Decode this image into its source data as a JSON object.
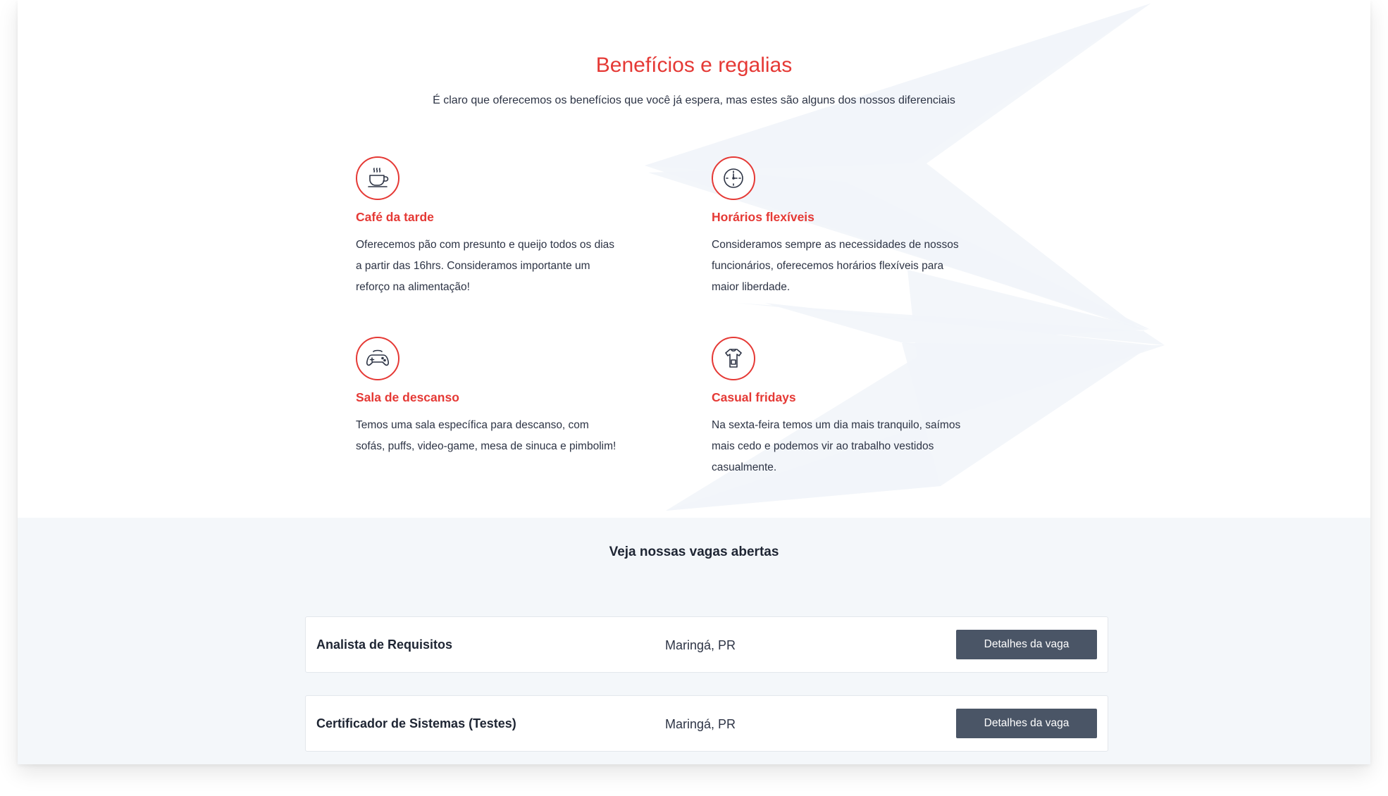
{
  "benefits": {
    "title": "Benefícios e regalias",
    "subtitle": "É claro que oferecemos os benefícios que você já espera, mas estes são alguns dos nossos diferenciais",
    "items": [
      {
        "icon": "coffee-cup-icon",
        "title": "Café da tarde",
        "text": "Oferecemos pão com presunto e queijo todos os dias a partir das 16hrs. Consideramos importante um reforço na alimentação!"
      },
      {
        "icon": "clock-icon",
        "title": "Horários flexíveis",
        "text": "Consideramos sempre as necessidades de nossos funcionários, oferecemos horários flexíveis para maior liberdade."
      },
      {
        "icon": "gamepad-icon",
        "title": "Sala de descanso",
        "text": "Temos uma sala específica para descanso, com sofás, puffs, video-game, mesa de sinuca e pimbolim!"
      },
      {
        "icon": "shirt-icon",
        "title": "Casual fridays",
        "text": "Na sexta-feira temos um dia mais tranquilo, saímos mais cedo e podemos vir ao trabalho vestidos casualmente."
      }
    ]
  },
  "jobs": {
    "title": "Veja nossas vagas abertas",
    "items": [
      {
        "title": "Analista de Requisitos",
        "location": "Maringá, PR",
        "button": "Detalhes da vaga"
      },
      {
        "title": "Certificador de Sistemas (Testes)",
        "location": "Maringá, PR",
        "button": "Detalhes da vaga"
      }
    ]
  },
  "colors": {
    "accent": "#e53935",
    "text": "#2d3445",
    "button": "#4a5566",
    "section_bg": "#f4f7fa"
  }
}
